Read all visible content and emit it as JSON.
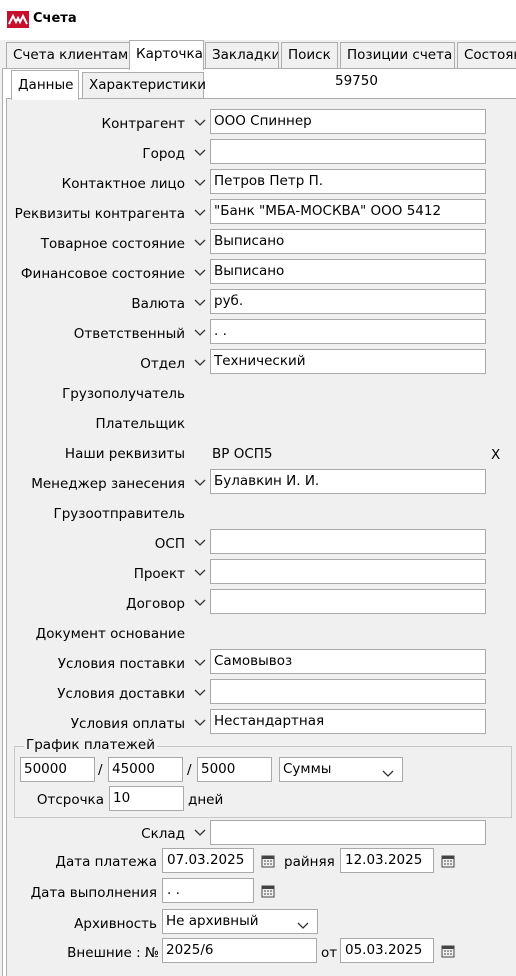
{
  "window": {
    "title": "Счета"
  },
  "tabs": [
    "Счета клиентам",
    "Карточка",
    "Закладки",
    "Поиск",
    "Позиции счета",
    "Состоян"
  ],
  "subtabs": [
    "Данные",
    "Характеристики"
  ],
  "record_id": "59750",
  "fields": {
    "kontragent": {
      "label": "Контрагент",
      "value": "ООО Спиннер"
    },
    "gorod": {
      "label": "Город",
      "value": ""
    },
    "kontaktnoe_lico": {
      "label": "Контактное лицо",
      "value": "Петров Петр П."
    },
    "rekvizity": {
      "label": "Реквизиты контрагента",
      "value": "\"Банк \"МБА-МОСКВА\" ООО 5412"
    },
    "tovarnoe": {
      "label": "Товарное состояние",
      "value": "Выписано"
    },
    "finansovoe": {
      "label": "Финансовое состояние",
      "value": "Выписано"
    },
    "valuta": {
      "label": "Валюта",
      "value": "руб."
    },
    "otvetstvennyi": {
      "label": "Ответственный",
      "value": ". ."
    },
    "otdel": {
      "label": "Отдел",
      "value": "Технический"
    },
    "gruzopoluchatel": {
      "label": "Грузополучатель"
    },
    "platelshchik": {
      "label": "Плательщик"
    },
    "nashi_rekvizity": {
      "label": "Наши реквизиты",
      "value": "ВР ОСП5",
      "clear": "X"
    },
    "menedzher": {
      "label": "Менеджер занесения",
      "value": "Булавкин И. И."
    },
    "gruzootpravitel": {
      "label": "Грузоотправитель"
    },
    "osp": {
      "label": "ОСП",
      "value": ""
    },
    "proekt": {
      "label": "Проект",
      "value": ""
    },
    "dogovor": {
      "label": "Договор",
      "value": ""
    },
    "dokument_osnovanie": {
      "label": "Документ основание"
    },
    "usloviya_postavki": {
      "label": "Условия поставки",
      "value": "Самовывоз"
    },
    "usloviya_dostavki": {
      "label": "Условия доставки",
      "value": ""
    },
    "usloviya_oplaty": {
      "label": "Условия оплаты",
      "value": "Нестандартная"
    }
  },
  "payment_schedule": {
    "title": "График платежей",
    "amount1": "50000",
    "sep1": "/",
    "amount2": "45000",
    "sep2": "/",
    "amount3": "5000",
    "mode": "Суммы",
    "delay_label": "Отсрочка",
    "delay_value": "10",
    "delay_unit": "дней"
  },
  "sklad": {
    "label": "Склад",
    "value": ""
  },
  "data_platezha": {
    "label": "Дата платежа",
    "value": "07.03.2025",
    "rainya_label": "райняя",
    "rainya_value": "12.03.2025"
  },
  "data_vypolneniya": {
    "label": "Дата выполнения",
    "value": " .  ."
  },
  "arkhivnost": {
    "label": "Архивность",
    "value": "Не архивный"
  },
  "vneshnie": {
    "label": "Внешние : №",
    "value": "2025/6",
    "ot_label": "от",
    "ot_value": "05.03.2025"
  }
}
